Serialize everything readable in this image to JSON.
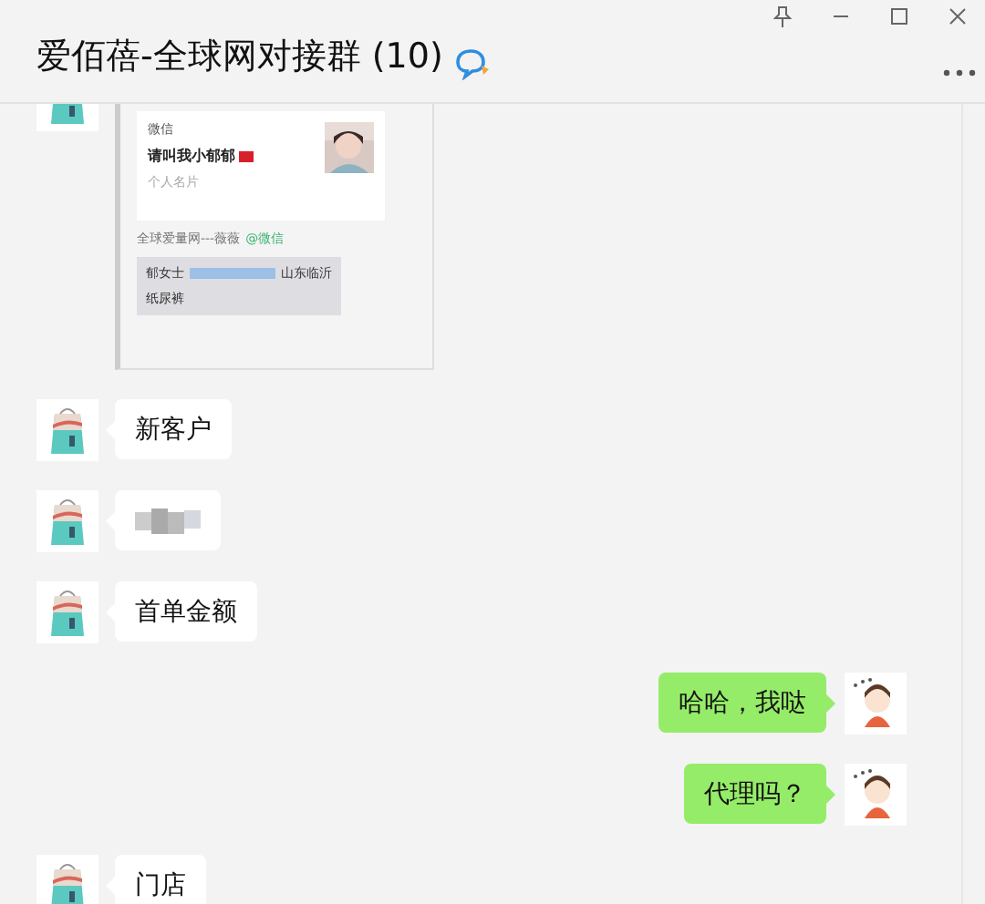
{
  "window": {
    "title": "爱佰蓓-全球网对接群 (10)"
  },
  "messages": [
    {
      "outgoing": false,
      "card": {
        "source": "微信",
        "name": "请叫我小郁郁",
        "footer": "个人名片"
      },
      "sender": "全球爱量网---薇薇",
      "sender_tag": "@微信",
      "note": {
        "line_1_start": "郁女士",
        "line_1_end": "山东临沂",
        "line_2": "纸尿裤"
      }
    },
    {
      "kind": "text",
      "outgoing": false,
      "text": "新客户"
    },
    {
      "kind": "blurred",
      "outgoing": false
    },
    {
      "kind": "text",
      "outgoing": false,
      "text": "首单金额"
    },
    {
      "kind": "text",
      "outgoing": true,
      "text": "哈哈，我哒"
    },
    {
      "kind": "text",
      "outgoing": true,
      "text": "代理吗？"
    },
    {
      "kind": "text",
      "outgoing": false,
      "text": "门店"
    }
  ]
}
